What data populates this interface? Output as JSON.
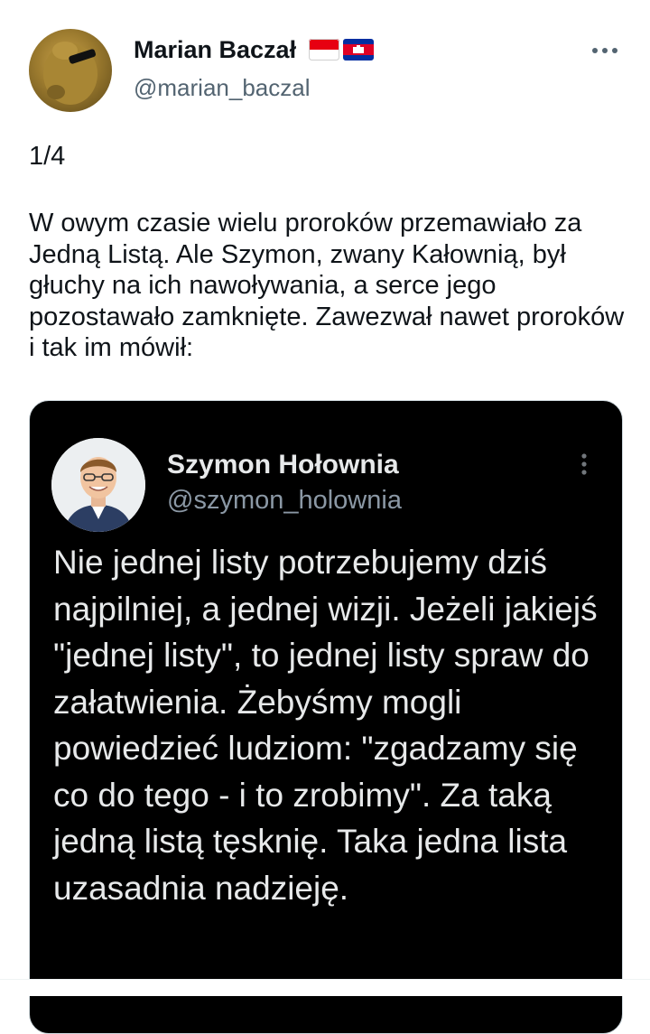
{
  "tweet": {
    "author": {
      "name": "Marian Baczał",
      "handle": "@marian_baczal",
      "flags": [
        "indonesia-flag-icon",
        "cambodia-flag-icon"
      ]
    },
    "more_icon": "more-horizontal-icon",
    "counter": "1/4",
    "body": "W owym czasie wielu proroków przemawiało za Jedną Listą. Ale Szymon, zwany Kałownią, był głuchy na ich nawoływania, a serce jego pozostawało zamknięte. Zawezwał nawet proroków i tak im mówił:"
  },
  "quote": {
    "author": {
      "name": "Szymon Hołownia",
      "handle": "@szymon_holownia"
    },
    "more_icon": "more-vertical-icon",
    "body": "Nie jednej listy potrzebujemy dziś najpilniej, a jednej wizji. Jeżeli jakiejś \"jednej listy\", to jednej listy spraw do załatwienia. Żebyśmy mogli powiedzieć ludziom: \"zgadzamy się co do tego - i to zrobimy\". Za taką jedną listą tęsknię. Taka jedna lista uzasadnia nadzieję."
  },
  "colors": {
    "text_primary": "#0f1419",
    "text_secondary": "#536471",
    "quote_background": "#000000",
    "quote_text": "#e7e9ea",
    "quote_handle": "#8b98a5"
  }
}
